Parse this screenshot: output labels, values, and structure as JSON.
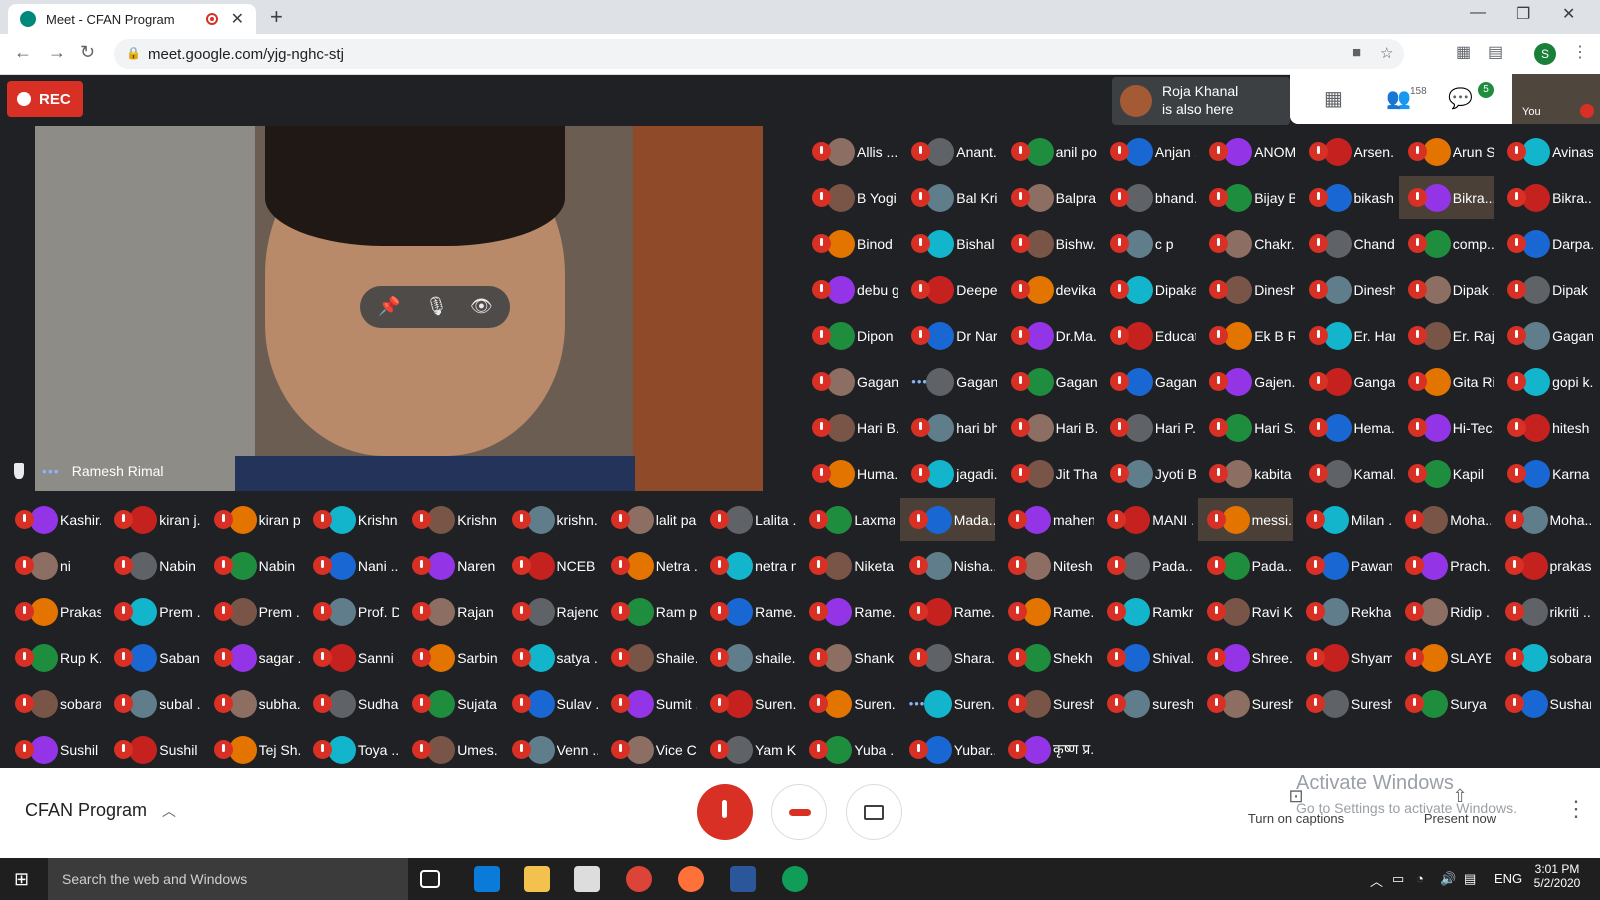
{
  "browser": {
    "tab_title": "Meet - CFAN Program",
    "url": "meet.google.com/yjg-nghc-stj",
    "profile_initial": "S"
  },
  "meeting": {
    "rec_label": "REC",
    "pinned_name": "Ramesh Rimal",
    "toast_line1": "Roja Khanal",
    "toast_line2": "is also here",
    "participants_count": "158",
    "chat_badge": "5",
    "self_label": "You",
    "meeting_name": "CFAN Program",
    "captions_label": "Turn on captions",
    "present_label": "Present now"
  },
  "watermark": {
    "line1": "Activate Windows",
    "line2": "Go to Settings to activate Windows."
  },
  "taskbar": {
    "search_placeholder": "Search the web and Windows",
    "lang": "ENG",
    "time": "3:01 PM",
    "date": "5/2/2020"
  },
  "colors": {
    "muted_red": "#d93025",
    "meet_bg": "#202124"
  },
  "grid_top": [
    [
      "Allis ...",
      "Anant...",
      "anil po...",
      "Anjan ...",
      "ANOM...",
      "Arsen...",
      "Arun S...",
      "Avinas..."
    ],
    [
      "B Yogi",
      "Bal Kri...",
      "Balpra...",
      "bhand...",
      "Bijay B...",
      "bikash...",
      "Bikra...",
      "Bikra..."
    ],
    [
      "Binod ...",
      "Bishal ...",
      "Bishw...",
      "c p",
      "Chakr...",
      "Chand...",
      "comp...",
      "Darpa..."
    ],
    [
      "debu g...",
      "Deepe...",
      "devika...",
      "Dipaka...",
      "Dinesh...",
      "Dinesh...",
      "Dipak ...",
      "Dipak ..."
    ],
    [
      "Dipon ...",
      "Dr Nar...",
      "Dr.Ma...",
      "Educat...",
      "Ek B R...",
      "Er. Har...",
      "Er. Raj ...",
      "Gagan..."
    ],
    [
      "Gagan...",
      "Gagan...",
      "Gagan...",
      "Gagan...",
      "Gajen...",
      "Ganga...",
      "Gita Ri...",
      "gopi k..."
    ],
    [
      "Hari B...",
      "hari bh...",
      "Hari B...",
      "Hari P...",
      "Hari S...",
      "Hema...",
      "Hi-Tec...",
      "hitesh ..."
    ],
    [
      "Huma...",
      "jagadi...",
      "Jit Tha...",
      "Jyoti B...",
      "kabita ...",
      "Kamal...",
      "Kapil",
      "Karna ..."
    ]
  ],
  "grid_bottom": [
    [
      "Kashir...",
      "kiran j...",
      "kiran p...",
      "Krishn...",
      "Krishn...",
      "krishn...",
      "lalit pa...",
      "Lalita ...",
      "Laxma...",
      "Mada...",
      "mahen...",
      "MANI ...",
      "messi...",
      "Milan ...",
      "Moha...",
      "Moha..."
    ],
    [
      "ni",
      "Nabin ...",
      "Nabin ...",
      "Nani ...",
      "Naren ...",
      "NCEB ...",
      "Netra ...",
      "netra n...",
      "Niketa...",
      "Nisha...",
      "Nitesh...",
      "Pada...",
      "Pada...",
      "Pawan...",
      "Prach...",
      "prakas..."
    ],
    [
      "Prakas...",
      "Prem ...",
      "Prem ...",
      "Prof. D...",
      "Rajan ...",
      "Rajend...",
      "Ram p...",
      "Rame...",
      "Rame...",
      "Rame...",
      "Rame...",
      "Ramkr...",
      "Ravi K...",
      "Rekha",
      "Ridip ...",
      "rikriti ..."
    ],
    [
      "Rup K...",
      "Saban ...",
      "sagar ...",
      "Sanni ...",
      "Sarbin...",
      "satya ...",
      "Shaile...",
      "shaile...",
      "Shank...",
      "Shara...",
      "Shekh...",
      "Shival...",
      "Shree...",
      "Shyam...",
      "SLAYE...",
      "sobara..."
    ],
    [
      "sobara...",
      "subal ...",
      "subha...",
      "Sudha ...",
      "Sujata ...",
      "Sulav ...",
      "Sumit ...",
      "Suren...",
      "Suren...",
      "Suren...",
      "Suresh...",
      "suresh...",
      "Suresh...",
      "Suresh...",
      "Surya ...",
      "Sushant"
    ],
    [
      "Sushil ...",
      "Sushil ...",
      "Tej Sh...",
      "Toya ...",
      "Umes...",
      "Venn ...",
      "Vice C...",
      "Yam K...",
      "Yuba ...",
      "Yubar...",
      "कृष्ण प्र..."
    ]
  ]
}
